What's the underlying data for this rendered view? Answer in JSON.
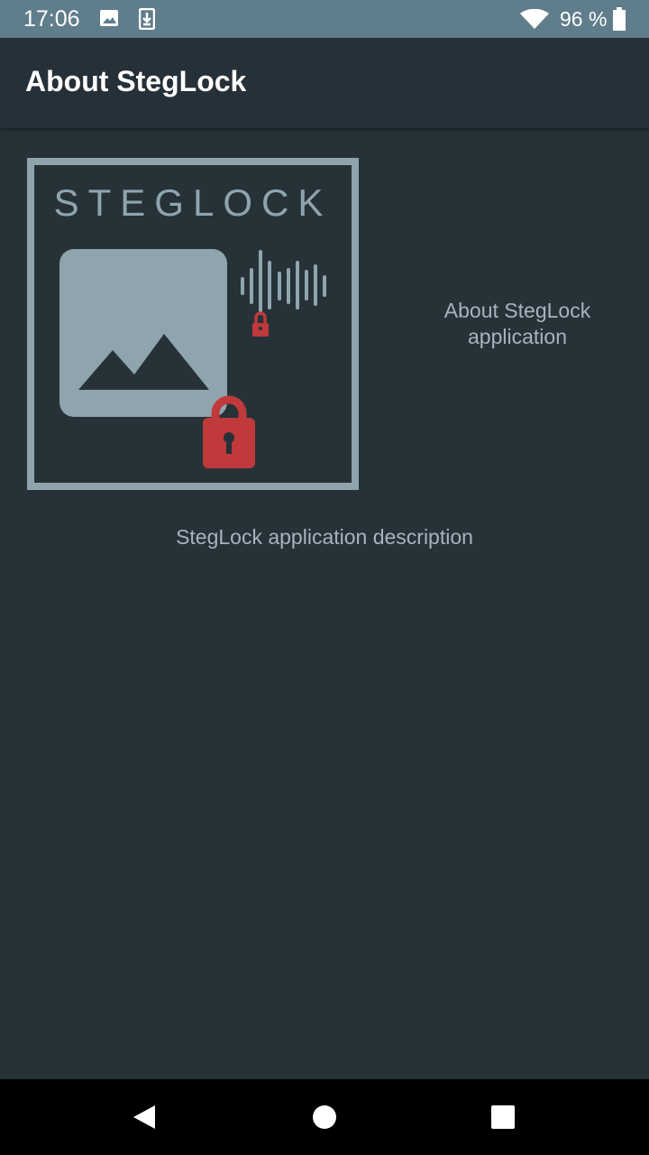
{
  "status_bar": {
    "time": "17:06",
    "battery_percent": "96 %",
    "icons": [
      "image-notification-icon",
      "download-notification-icon",
      "wifi-icon",
      "battery-icon"
    ]
  },
  "app_bar": {
    "title": "About StegLock"
  },
  "logo": {
    "wordmark": "STEGLOCK",
    "frame_color": "#90a4ae",
    "lock_color": "#c0393b"
  },
  "main": {
    "about_label": "About StegLock application",
    "description": "StegLock application description"
  },
  "nav_bar": {
    "buttons": [
      "back-icon",
      "home-icon",
      "recents-icon"
    ]
  },
  "colors": {
    "status_bar": "#607d8b",
    "app_bar": "#263038",
    "background": "#263238",
    "secondary_text": "#a6b4bd"
  }
}
